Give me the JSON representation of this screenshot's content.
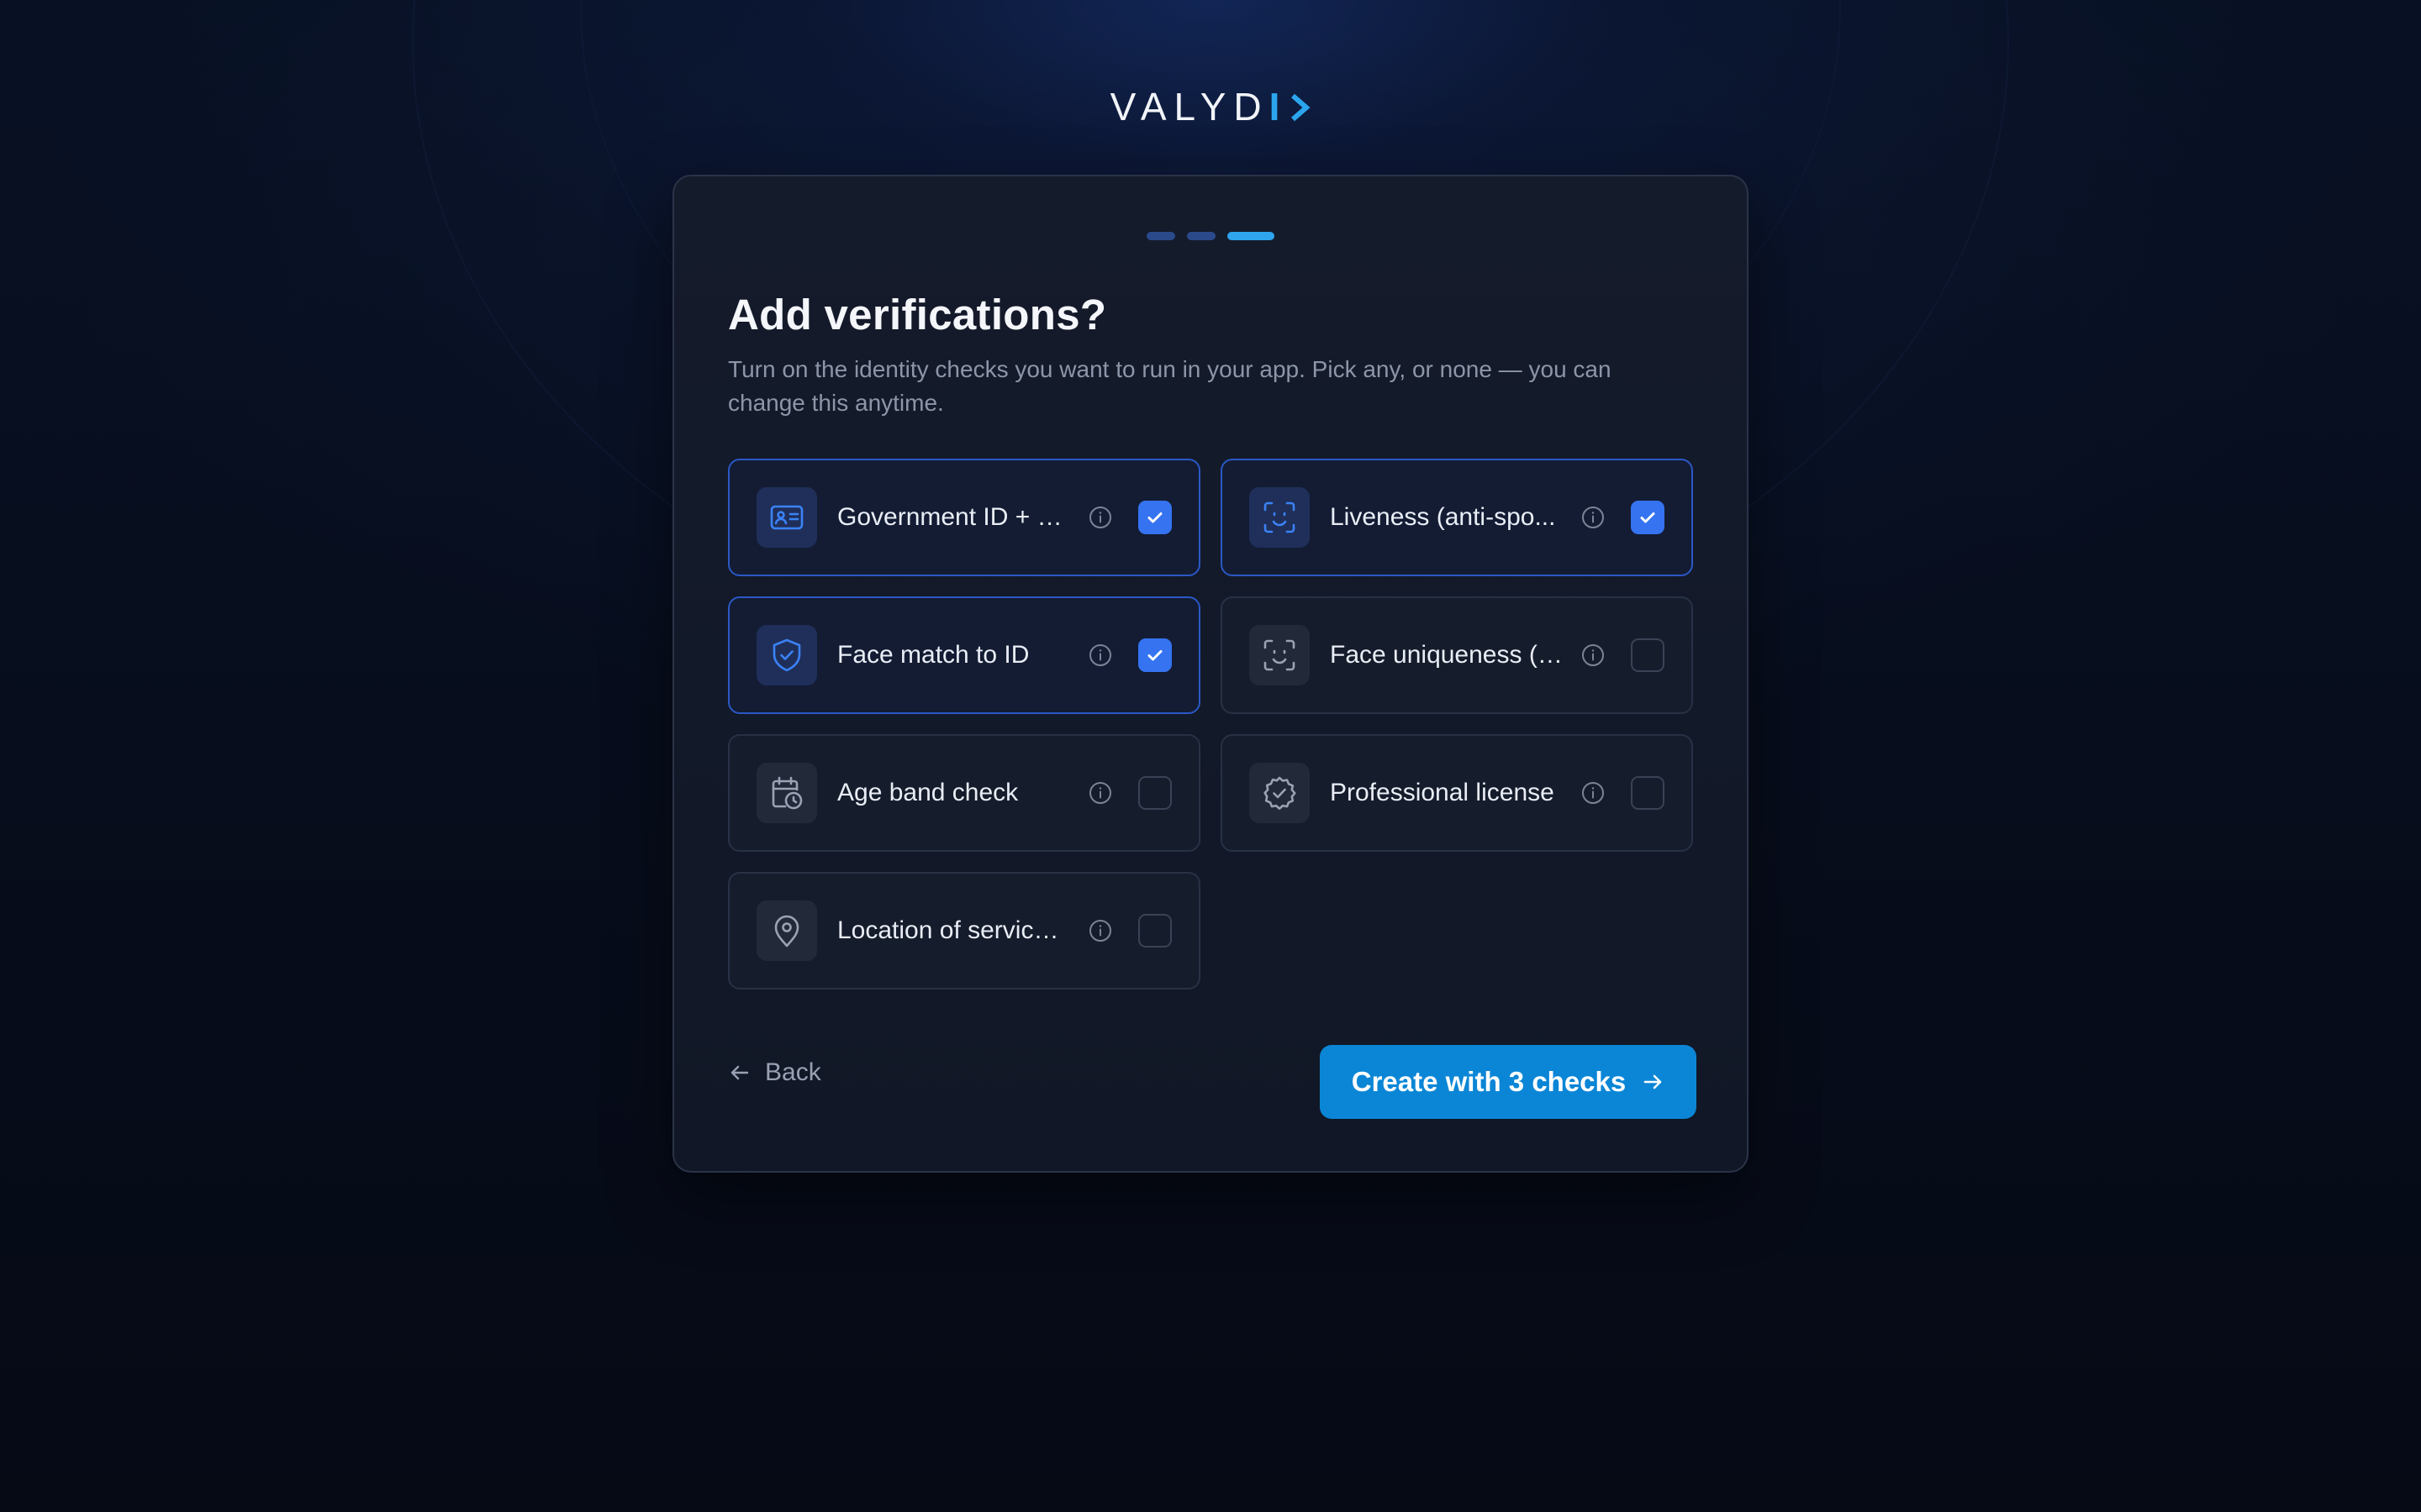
{
  "brand": {
    "logo_main": "VALYD",
    "logo_accent": "I",
    "accent_color": "#2ba6ee"
  },
  "progress": {
    "total_steps": 3,
    "current_step": 3
  },
  "header": {
    "title": "Add verifications?",
    "subtitle": "Turn on the identity checks you want to run in your app. Pick any, or none — you can change this anytime."
  },
  "options": [
    {
      "label": "Government ID + O...",
      "icon": "id-card-icon",
      "checked": true
    },
    {
      "label": "Liveness (anti-spo...",
      "icon": "face-scan-icon",
      "checked": true
    },
    {
      "label": "Face match to ID",
      "icon": "shield-check-icon",
      "checked": true
    },
    {
      "label": "Face uniqueness (o...",
      "icon": "face-scan-icon",
      "checked": false
    },
    {
      "label": "Age band check",
      "icon": "calendar-clock-icon",
      "checked": false
    },
    {
      "label": "Professional license",
      "icon": "badge-check-icon",
      "checked": false
    },
    {
      "label": "Location of service ...",
      "icon": "map-pin-icon",
      "checked": false
    }
  ],
  "footer": {
    "back_label": "Back",
    "cta_label": "Create with 3 checks"
  },
  "colors": {
    "checked": "#3573f0",
    "cta": "#0b86d6",
    "selected_border": "#2b58c6"
  }
}
